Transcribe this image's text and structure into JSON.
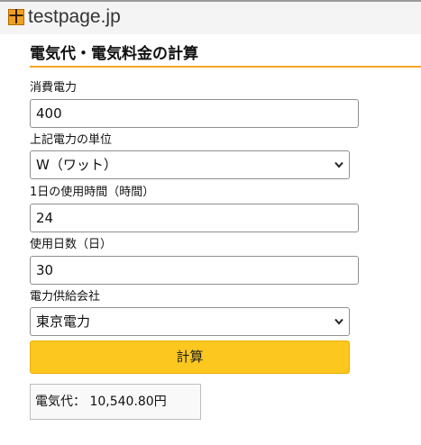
{
  "header": {
    "logo_glyph": "十",
    "site_name": "testpage.jp"
  },
  "page_title": "電気代・電気料金の計算",
  "form": {
    "power": {
      "label": "消費電力",
      "value": "400"
    },
    "unit": {
      "label": "上記電力の単位",
      "selected": "W（ワット）"
    },
    "hours": {
      "label": "1日の使用時間（時間）",
      "value": "24"
    },
    "days": {
      "label": "使用日数（日）",
      "value": "30"
    },
    "company": {
      "label": "電力供給会社",
      "selected": "東京電力"
    },
    "calculate_label": "計算"
  },
  "result": {
    "label": "電気代：",
    "value": "10,540.80円"
  },
  "colors": {
    "accent": "#f6a623",
    "button": "#fcc71f"
  }
}
